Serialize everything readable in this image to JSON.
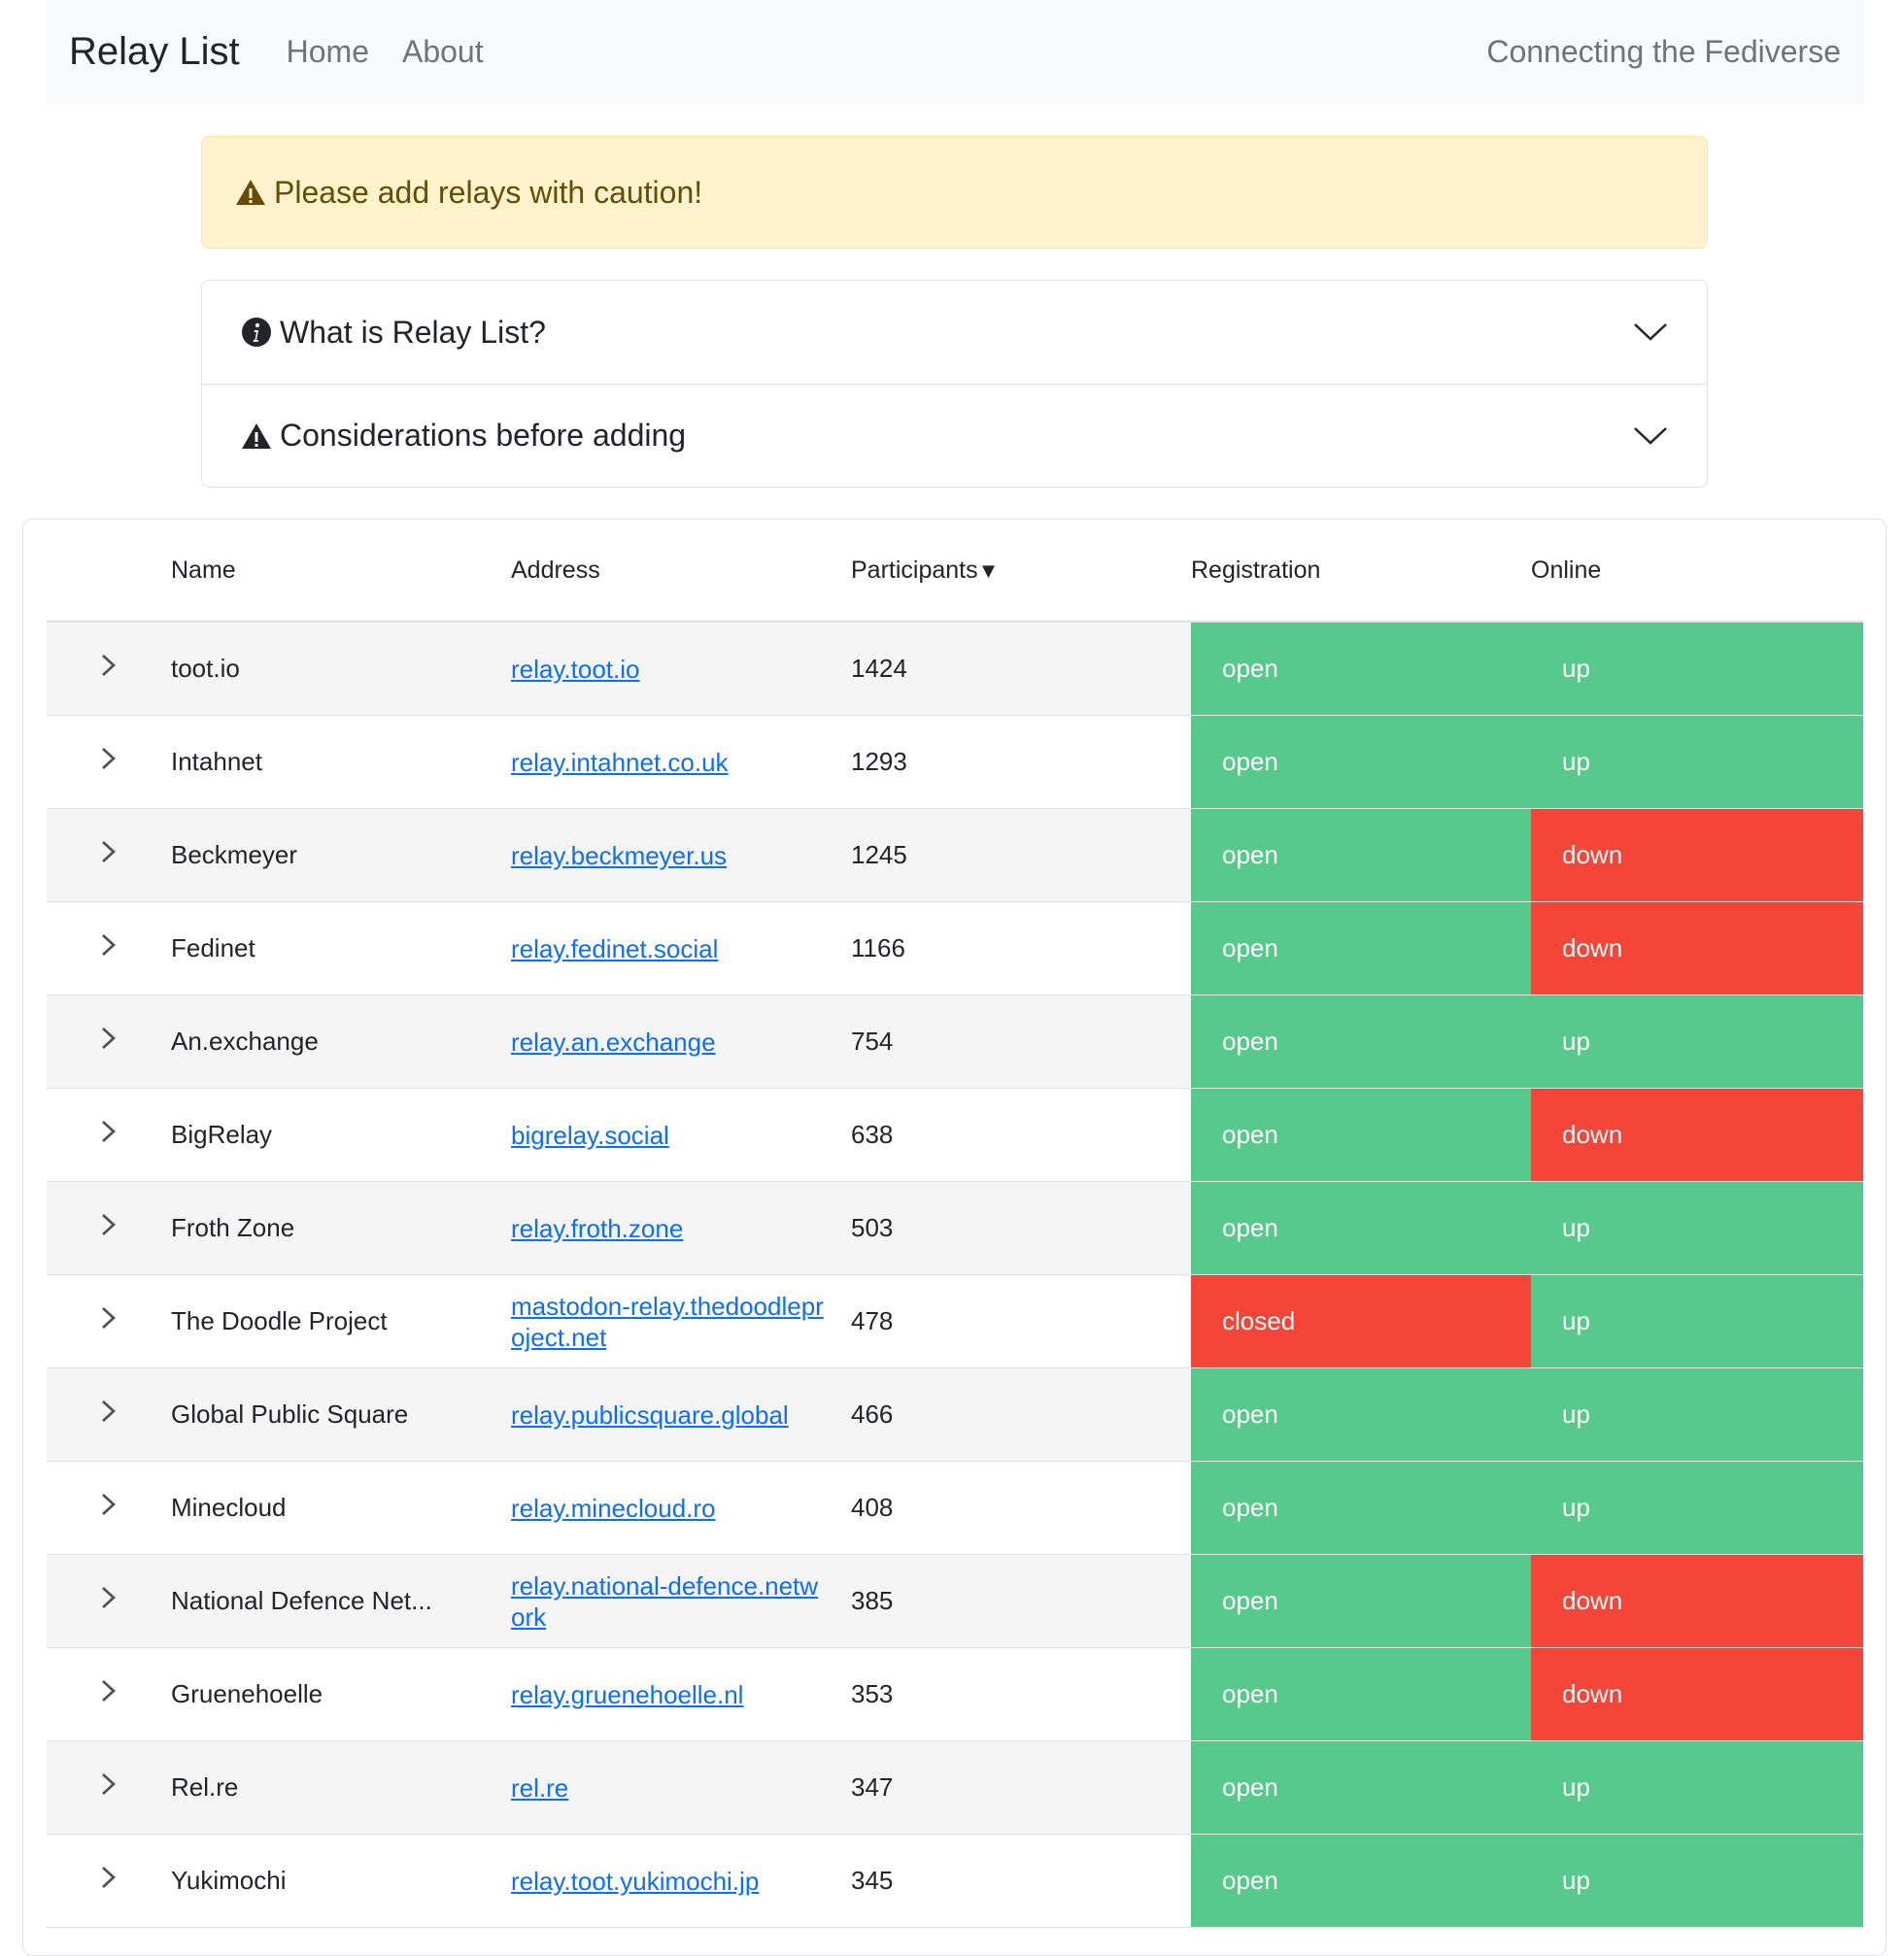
{
  "nav": {
    "brand": "Relay List",
    "links": [
      "Home",
      "About"
    ],
    "tagline": "Connecting the Fediverse"
  },
  "alert": {
    "text": "Please add relays with caution!",
    "icon": "warning-icon"
  },
  "accordion": [
    {
      "label": "What is Relay List?",
      "icon": "info-icon"
    },
    {
      "label": "Considerations before adding",
      "icon": "warning-icon"
    }
  ],
  "table": {
    "headers": {
      "name": "Name",
      "address": "Address",
      "participants": "Participants",
      "sort_indicator": "▼",
      "registration": "Registration",
      "online": "Online"
    },
    "rows": [
      {
        "name": "toot.io",
        "address": "relay.toot.io",
        "participants": "1424",
        "registration": "open",
        "online": "up"
      },
      {
        "name": "Intahnet",
        "address": "relay.intahnet.co.uk",
        "participants": "1293",
        "registration": "open",
        "online": "up"
      },
      {
        "name": "Beckmeyer",
        "address": "relay.beckmeyer.us",
        "participants": "1245",
        "registration": "open",
        "online": "down"
      },
      {
        "name": "Fedinet",
        "address": "relay.fedinet.social",
        "participants": "1166",
        "registration": "open",
        "online": "down"
      },
      {
        "name": "An.exchange",
        "address": "relay.an.exchange",
        "participants": "754",
        "registration": "open",
        "online": "up"
      },
      {
        "name": "BigRelay",
        "address": "bigrelay.social",
        "participants": "638",
        "registration": "open",
        "online": "down"
      },
      {
        "name": "Froth Zone",
        "address": "relay.froth.zone",
        "participants": "503",
        "registration": "open",
        "online": "up"
      },
      {
        "name": "The Doodle Project",
        "address": "mastodon-relay.thedoodleproject.net",
        "participants": "478",
        "registration": "closed",
        "online": "up"
      },
      {
        "name": "Global Public Square",
        "address": "relay.publicsquare.global",
        "participants": "466",
        "registration": "open",
        "online": "up"
      },
      {
        "name": "Minecloud",
        "address": "relay.minecloud.ro",
        "participants": "408",
        "registration": "open",
        "online": "up"
      },
      {
        "name": "National Defence Net...",
        "address": "relay.national-defence.network",
        "participants": "385",
        "registration": "open",
        "online": "down"
      },
      {
        "name": "Gruenehoelle",
        "address": "relay.gruenehoelle.nl",
        "participants": "353",
        "registration": "open",
        "online": "down"
      },
      {
        "name": "Rel.re",
        "address": "rel.re",
        "participants": "347",
        "registration": "open",
        "online": "up"
      },
      {
        "name": "Yukimochi",
        "address": "relay.toot.yukimochi.jp",
        "participants": "345",
        "registration": "open",
        "online": "up"
      }
    ]
  },
  "colors": {
    "status_good": "#57c98b",
    "status_bad": "#f44538",
    "link": "#0d6efd",
    "alert_bg": "#fff3cd"
  }
}
